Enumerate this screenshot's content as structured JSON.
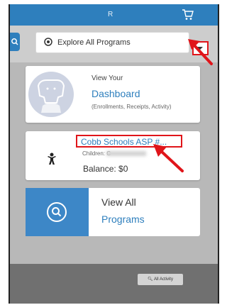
{
  "header": {
    "user_name": "R",
    "cart_icon": "cart-icon"
  },
  "filter": {
    "search_icon": "search-icon",
    "select_icon": "target-icon",
    "selected_program": "Explore All Programs",
    "dropdown_icon": "caret-down-icon"
  },
  "dashboard_card": {
    "avatar_icon": "user-avatar-icon",
    "intro": "View Your",
    "link": "Dashboard",
    "subtitle": "(Enrollments, Receipts, Activity)"
  },
  "enrollment_card": {
    "child_icon": "child-icon",
    "program_link": "Cobb Schools ASP #...",
    "children_label": "Children: C",
    "balance": "Balance: $0"
  },
  "programs_card": {
    "icon": "search-icon",
    "line1": "View All",
    "link": "Programs"
  },
  "footer": {
    "activity_button": "All Activity"
  },
  "colors": {
    "brand_blue": "#2e7fbd",
    "programs_blue": "#3d87c7",
    "highlight_red": "#e0151a"
  }
}
